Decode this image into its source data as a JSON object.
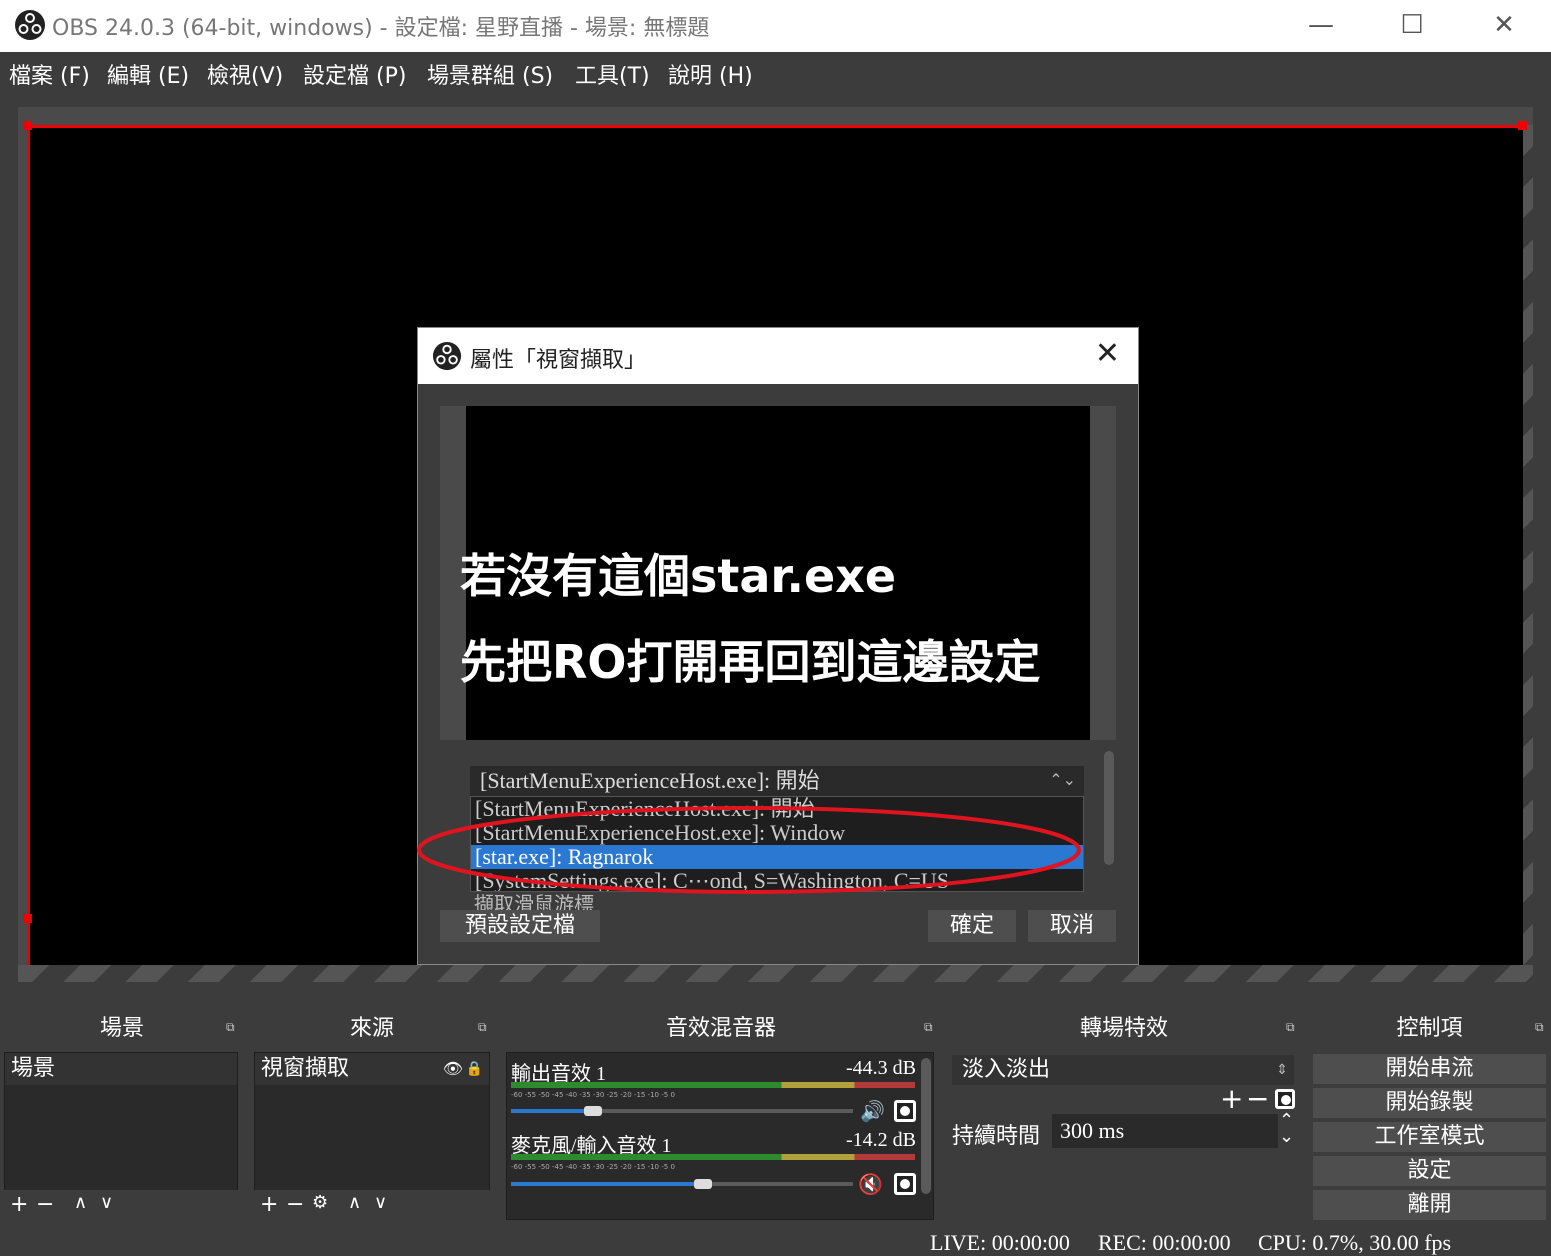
{
  "window": {
    "title": "OBS 24.0.3 (64-bit, windows) - 設定檔: 星野直播 - 場景: 無標題",
    "minimize": "—",
    "maximize": "☐",
    "close": "✕"
  },
  "menu": [
    "檔案 (F)",
    "編輯 (E)",
    "檢視(V)",
    "設定檔 (P)",
    "場景群組 (S)",
    "工具(T)",
    "說明 (H)"
  ],
  "dialog": {
    "title": "屬性「視窗擷取」",
    "close": "✕",
    "overlay_line1": "若沒有這個star.exe",
    "overlay_line2": "先把RO打開再回到這邊設定",
    "selected_window": "[StartMenuExperienceHost.exe]: 開始",
    "select_arrow": "⌃⌄",
    "dropdown_items": [
      "[StartMenuExperienceHost.exe]: 開始",
      "[StartMenuExperienceHost.exe]: Window",
      "[star.exe]: Ragnarok",
      "[SystemSettings.exe]: C⋯ond, S=Washington, C=US"
    ],
    "highlighted_index": 2,
    "partial_checkbox_label": "擷取滑鼠游標",
    "defaults_button": "預設設定檔",
    "ok_button": "確定",
    "cancel_button": "取消",
    "annotation_color": "#e0141e"
  },
  "docks": {
    "scenes": {
      "title": "場景",
      "items": [
        "場景"
      ],
      "toolbar": [
        "+",
        "−",
        "∧",
        "∨"
      ]
    },
    "sources": {
      "title": "來源",
      "items": [
        "視窗擷取"
      ],
      "toolbar": [
        "+",
        "−",
        "⚙",
        "∧",
        "∨"
      ]
    },
    "mixer": {
      "title": "音效混音器",
      "channels": [
        {
          "name": "輸出音效 1",
          "db": "-44.3 dB",
          "volume": 0.24,
          "muted": false
        },
        {
          "name": "麥克風/輸入音效 1",
          "db": "-14.2 dB",
          "volume": 0.56,
          "muted": true
        }
      ],
      "ticks": "-60 -55 -50 -45 -40 -35 -30 -25 -20 -15 -10 -5 0"
    },
    "transitions": {
      "title": "轉場特效",
      "selected": "淡入淡出",
      "duration_label": "持續時間",
      "duration_value": "300 ms",
      "add": "+",
      "remove": "−"
    },
    "controls": {
      "title": "控制項",
      "buttons": [
        "開始串流",
        "開始錄製",
        "工作室模式",
        "設定",
        "離開"
      ]
    }
  },
  "status": {
    "live": "LIVE: 00:00:00",
    "rec": "REC: 00:00:00",
    "cpu": "CPU: 0.7%, 30.00 fps"
  },
  "colors": {
    "accent": "#2a78d2",
    "selection_border": "#ee0000",
    "panel": "#3c3c3c"
  }
}
